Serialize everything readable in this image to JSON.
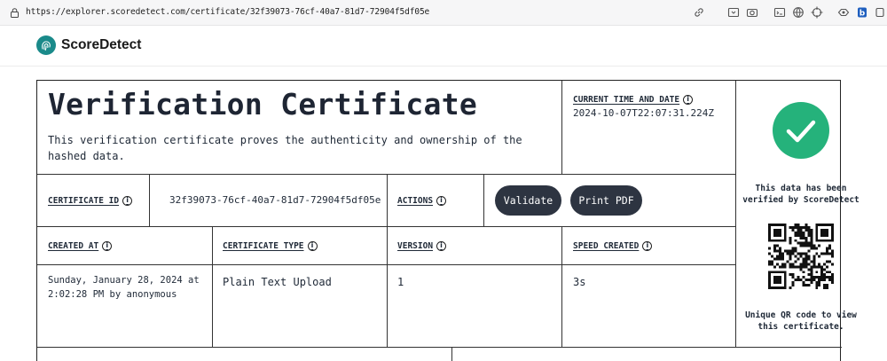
{
  "browser": {
    "url": "https://explorer.scoredetect.com/certificate/32f39073-76cf-40a7-81d7-72904f5df05e"
  },
  "app": {
    "brand": "ScoreDetect"
  },
  "certificate": {
    "title": "Verification Certificate",
    "description": "This verification certificate proves the authenticity and ownership of the hashed data.",
    "current_time": {
      "label": "CURRENT TIME AND DATE",
      "value": "2024-10-07T22:07:31.224Z"
    },
    "certificate_id": {
      "label": "CERTIFICATE ID",
      "value": "32f39073-76cf-40a7-81d7-72904f5df05e"
    },
    "actions": {
      "label": "ACTIONS",
      "validate": "Validate",
      "print_pdf": "Print PDF"
    },
    "created_at": {
      "label": "CREATED AT",
      "value_line1": "Sunday, January 28, 2024 at",
      "value_line2": "2:02:28 PM by anonymous"
    },
    "certificate_type": {
      "label": "CERTIFICATE TYPE",
      "value": "Plain Text Upload"
    },
    "version": {
      "label": "VERSION",
      "value": "1"
    },
    "speed_created": {
      "label": "SPEED CREATED",
      "value": "3s"
    },
    "verified": {
      "line1": "This data has been",
      "line2": "verified by ScoreDetect"
    },
    "qr": {
      "line1": "Unique QR code to view",
      "line2": "this certificate."
    }
  },
  "colors": {
    "verified_green": "#25b27b",
    "button_bg": "#2d3441",
    "brand_teal": "#1a8a8a"
  },
  "icons": [
    "lock-icon",
    "link-icon",
    "screenshot-icon",
    "camera-icon",
    "terminal-icon",
    "globe-icon",
    "crosshair-icon",
    "extension-icon",
    "badge-icon",
    "logo-icon",
    "info-icon",
    "checkmark-icon",
    "qr-code"
  ]
}
